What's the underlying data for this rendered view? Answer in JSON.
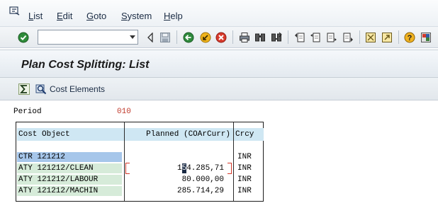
{
  "menu": {
    "items": [
      {
        "label": "List",
        "underline": "L",
        "rest": "ist"
      },
      {
        "label": "Edit",
        "underline": "E",
        "rest": "dit"
      },
      {
        "label": "Goto",
        "underline": "G",
        "rest": "oto"
      },
      {
        "label": "System",
        "underline": "S",
        "rest": "ystem"
      },
      {
        "label": "Help",
        "underline": "H",
        "rest": "elp"
      }
    ]
  },
  "toolbar": {
    "command_field_value": "",
    "icons": [
      "enter-icon",
      "back-icon",
      "exit-icon",
      "cancel-icon",
      "print-icon",
      "find-icon",
      "find-next-icon",
      "first-page-icon",
      "previous-page-icon",
      "next-page-icon",
      "last-page-icon",
      "create-session-icon",
      "shortcut-icon",
      "help-icon",
      "customize-layout-icon"
    ]
  },
  "title": "Plan Cost Splitting: List",
  "app_toolbar": {
    "cost_elements_label": "Cost Elements"
  },
  "period": {
    "label": "Period",
    "value": "010"
  },
  "list": {
    "headers": {
      "cost_object": "Cost Object",
      "planned": "Planned (COArCurr)",
      "currency": "Crcy"
    },
    "rows": [
      {
        "object": "CTR 121212",
        "planned": "",
        "currency": "INR"
      },
      {
        "object": "ATY 121212/CLEAN",
        "planned": "154.285,71",
        "currency": "INR"
      },
      {
        "object": "ATY 121212/LABOUR",
        "planned": "80.000,00",
        "currency": "INR"
      },
      {
        "object": "ATY 121212/MACHIN",
        "planned": "285.714,29",
        "currency": "INR"
      }
    ]
  },
  "colors": {
    "accent": "#1b2c44",
    "period_value": "#c0392b",
    "header_bg": "#cfe7f3",
    "object_bg": "#d6ebd9",
    "selected_bg": "#a6c6ea"
  }
}
